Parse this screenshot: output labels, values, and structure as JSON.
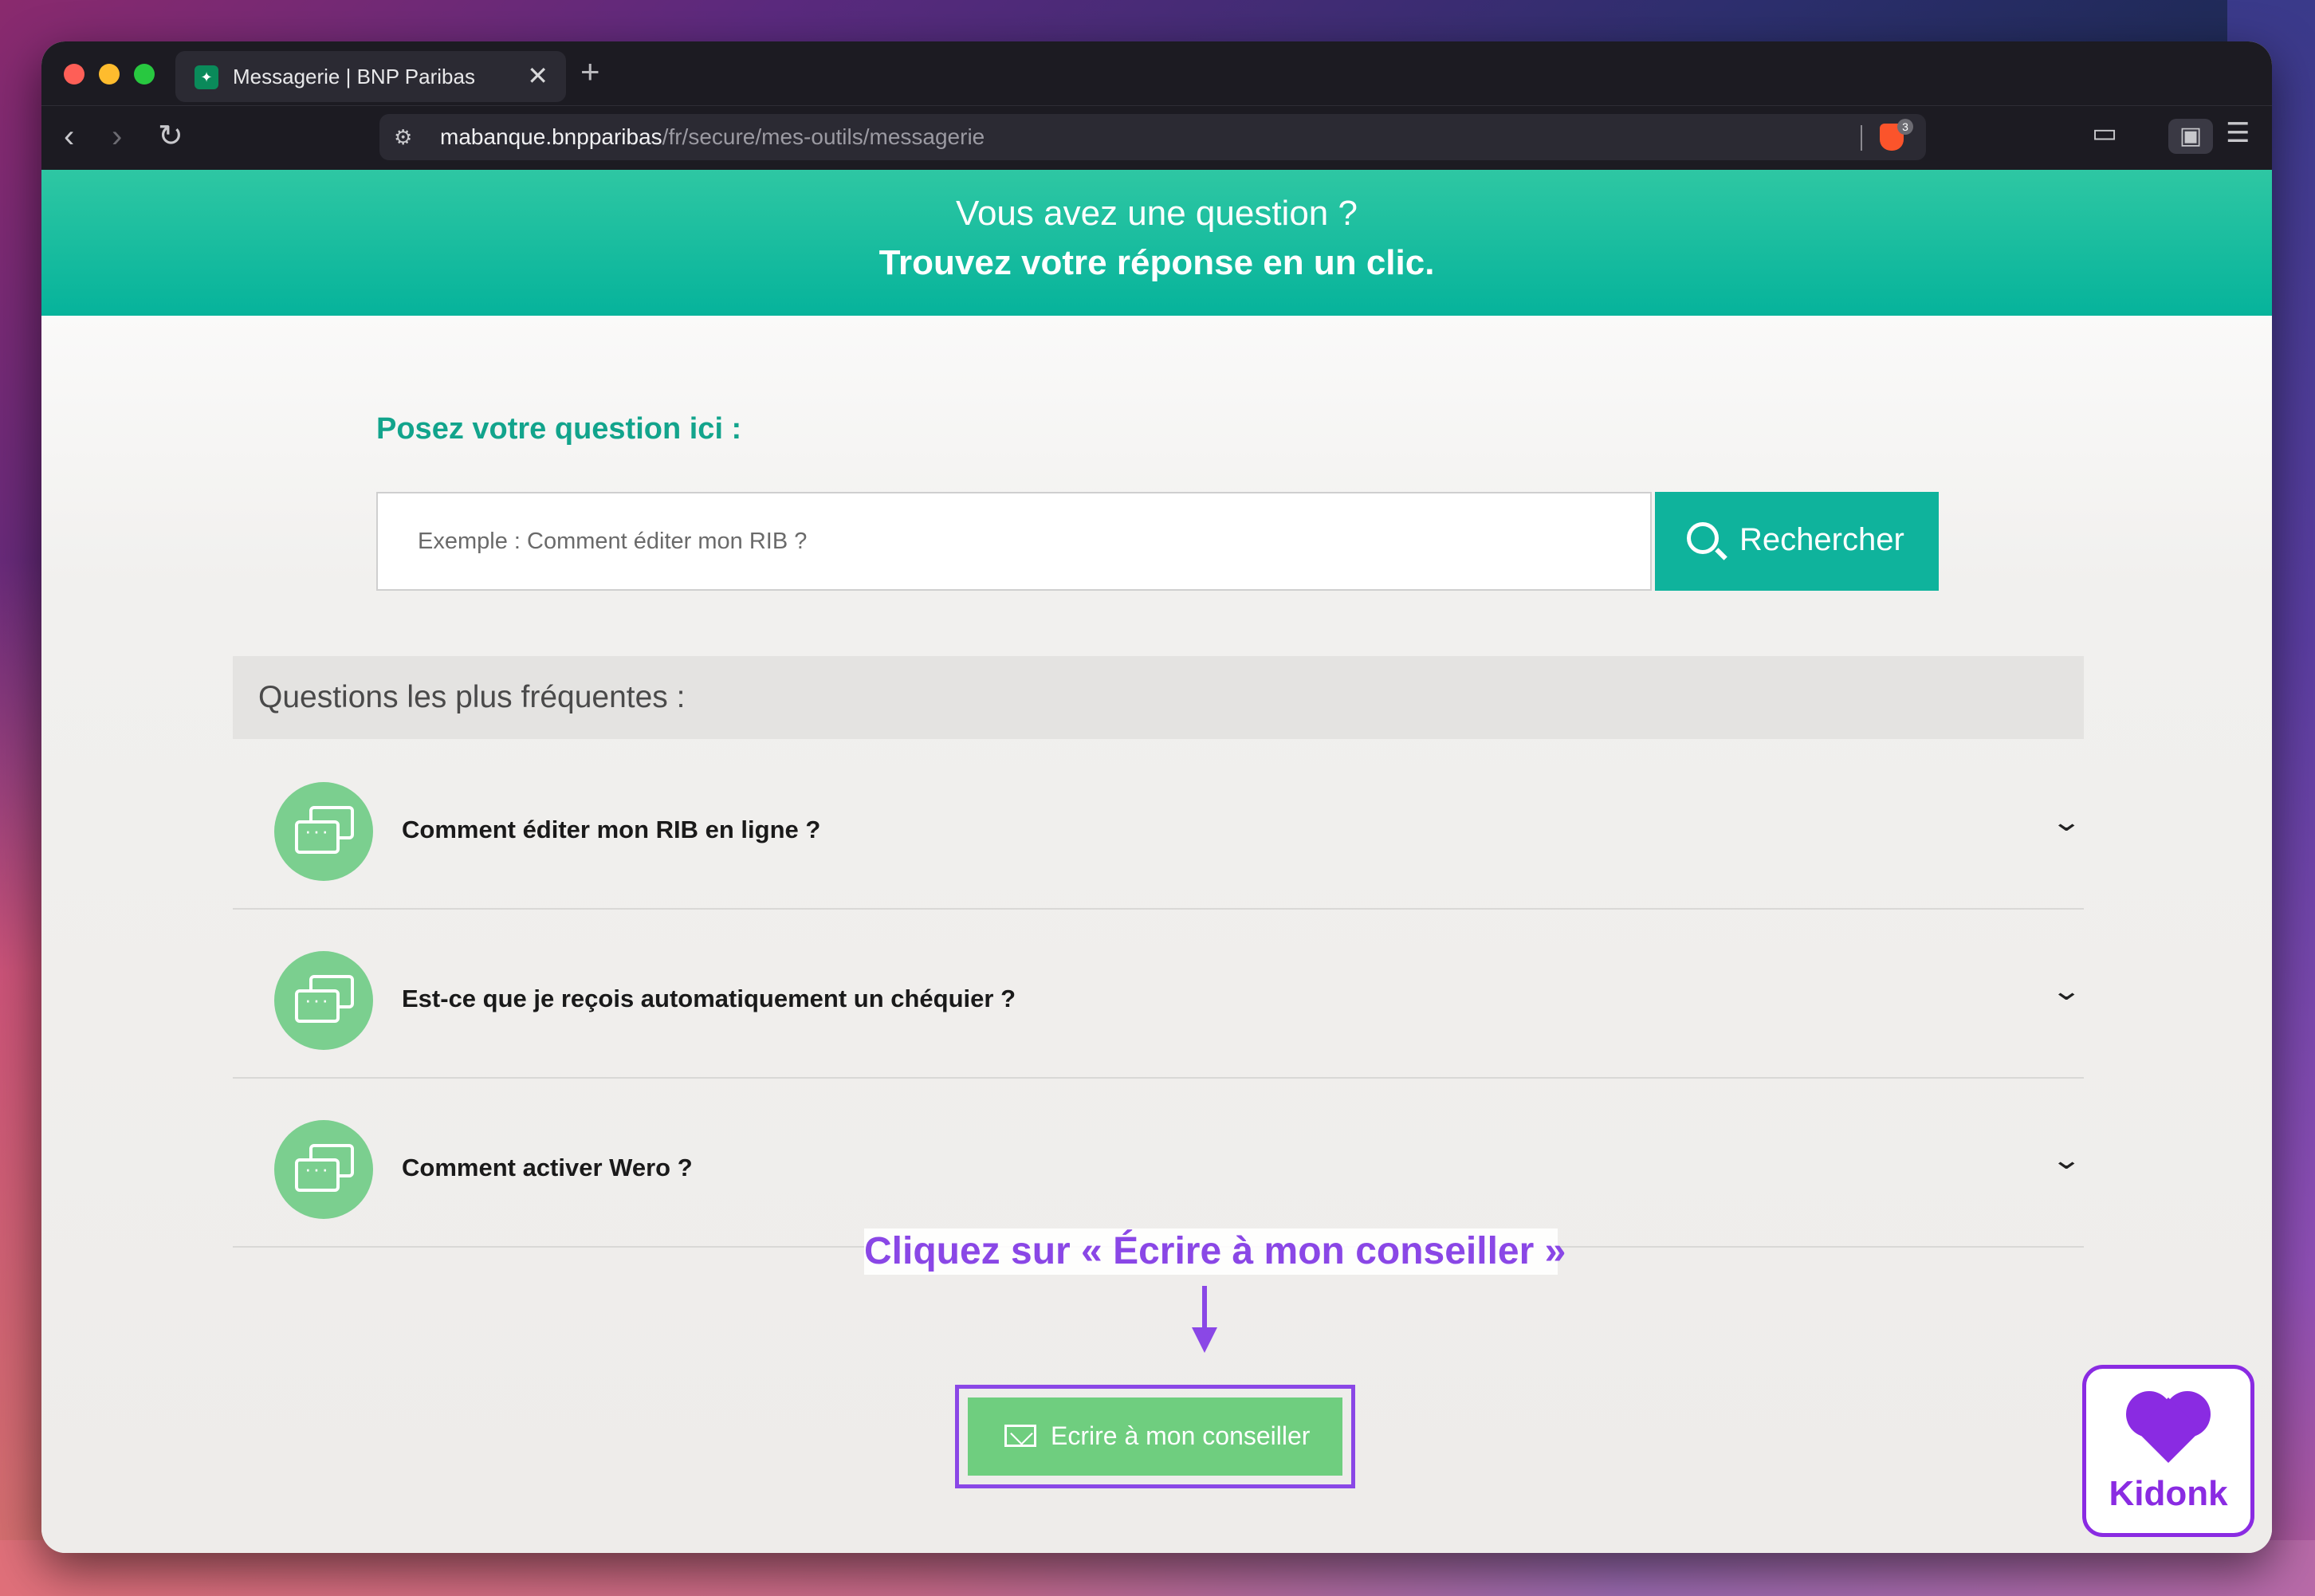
{
  "browser": {
    "tab_title": "Messagerie | BNP Paribas",
    "tab_close": "✕",
    "new_tab": "+",
    "url_host": "mabanque.bnpparibas",
    "url_path": "/fr/secure/mes-outils/messagerie",
    "shields_count": "3"
  },
  "banner": {
    "line1": "Vous avez une question ?",
    "line2": "Trouvez votre réponse en un clic."
  },
  "search": {
    "label": "Posez votre question ici :",
    "placeholder": "Exemple : Comment éditer mon RIB ?",
    "button_label": "Rechercher"
  },
  "faq": {
    "header": "Questions les plus fréquentes :",
    "items": [
      {
        "question": "Comment éditer mon RIB en ligne ?"
      },
      {
        "question": "Est-ce que je reçois automatiquement un chéquier ?"
      },
      {
        "question": "Comment activer Wero ?"
      }
    ]
  },
  "annotation": {
    "text": "Cliquez sur « Écrire à mon conseiller »",
    "color": "#8a47e6"
  },
  "cta": {
    "label": "Ecrire à mon conseiller"
  },
  "brand_badge": {
    "text": "Kidonk",
    "color": "#8a2be2"
  },
  "colors": {
    "primary_teal": "#0fb39c",
    "faq_icon_green": "#7bcf8f",
    "cta_green": "#6fce7f"
  }
}
